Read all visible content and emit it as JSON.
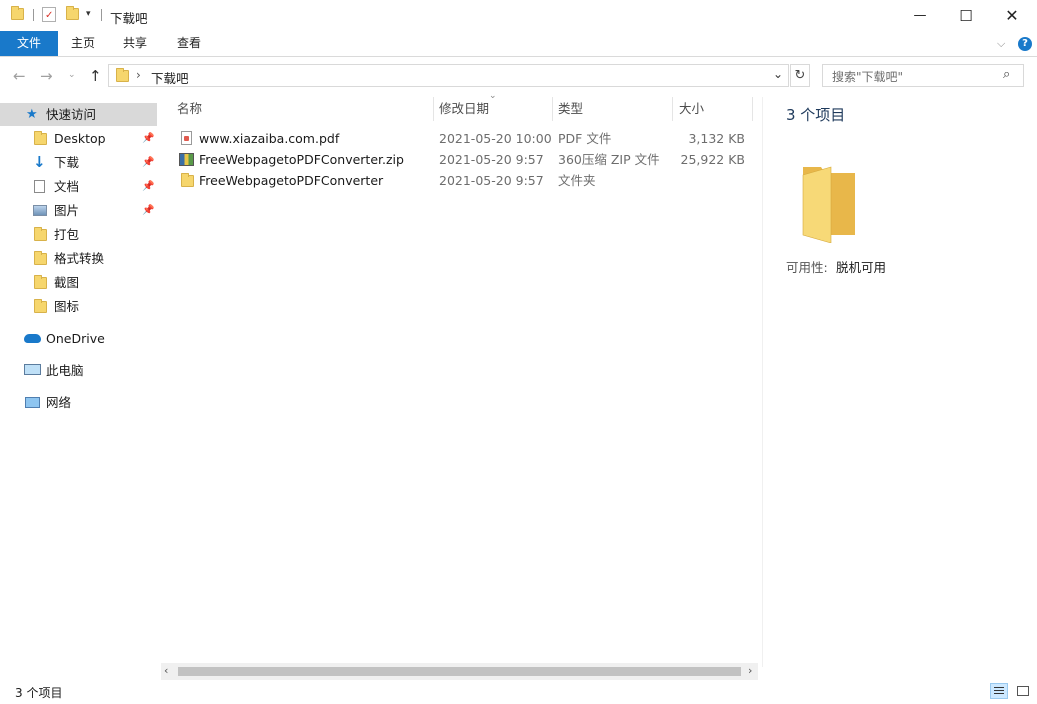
{
  "window": {
    "title": "下载吧",
    "controls": {
      "minimize": "—",
      "maximize": "☐",
      "close": "✕"
    }
  },
  "ribbon": {
    "tabs": [
      {
        "label": "文件",
        "active": true
      },
      {
        "label": "主页"
      },
      {
        "label": "共享"
      },
      {
        "label": "查看"
      }
    ],
    "help_icon": "?"
  },
  "address": {
    "path_label": "下载吧",
    "search_placeholder": "搜索\"下载吧\""
  },
  "nav": {
    "quick_access": "快速访问",
    "items": [
      {
        "label": "Desktop",
        "pinned": true,
        "icon": "folder-icon"
      },
      {
        "label": "下载",
        "pinned": true,
        "icon": "download-icon"
      },
      {
        "label": "文档",
        "pinned": true,
        "icon": "document-icon"
      },
      {
        "label": "图片",
        "pinned": true,
        "icon": "picture-icon"
      },
      {
        "label": "打包",
        "pinned": false,
        "icon": "folder-icon"
      },
      {
        "label": "格式转换",
        "pinned": false,
        "icon": "folder-icon"
      },
      {
        "label": "截图",
        "pinned": false,
        "icon": "folder-icon"
      },
      {
        "label": "图标",
        "pinned": false,
        "icon": "folder-icon"
      }
    ],
    "onedrive": "OneDrive",
    "this_pc": "此电脑",
    "network": "网络"
  },
  "files": {
    "columns": {
      "name": "名称",
      "modified": "修改日期",
      "type": "类型",
      "size": "大小"
    },
    "rows": [
      {
        "name": "www.xiazaiba.com.pdf",
        "modified": "2021-05-20 10:00",
        "type": "PDF 文件",
        "size": "3,132 KB",
        "icon": "pdf-file-icon"
      },
      {
        "name": "FreeWebpagetoPDFConverter.zip",
        "modified": "2021-05-20 9:57",
        "type": "360压缩 ZIP 文件",
        "size": "25,922 KB",
        "icon": "zip-file-icon"
      },
      {
        "name": "FreeWebpagetoPDFConverter",
        "modified": "2021-05-20 9:57",
        "type": "文件夹",
        "size": "",
        "icon": "folder-icon"
      }
    ]
  },
  "details": {
    "count": "3 个项目",
    "availability_label": "可用性:",
    "availability_value": "脱机可用"
  },
  "status": {
    "count": "3 个项目"
  },
  "colors": {
    "accent": "#1979ca",
    "selection": "#cce8ff",
    "folder": "#f6d66d"
  }
}
